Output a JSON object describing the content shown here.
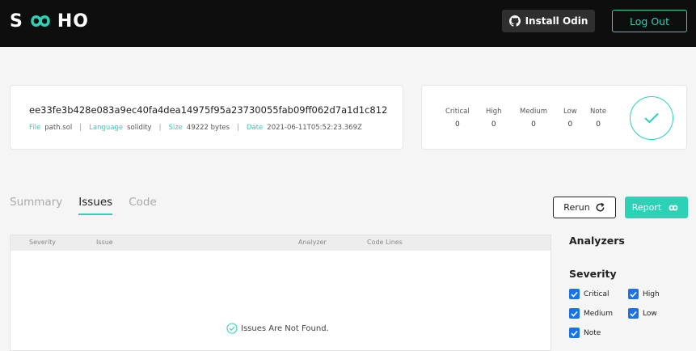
{
  "header": {
    "logo_left": "S",
    "logo_right": "HO",
    "install_label": "Install Odin",
    "logout_label": "Log Out"
  },
  "file": {
    "hash": "ee33fe3b428e083a9ec40fa4dea14975f95a23730055fab09ff062d7a1d1c812",
    "file_key": "File",
    "file_name": "path.sol",
    "language_key": "Language",
    "language": "solidity",
    "size_key": "Size",
    "size": "49222 bytes",
    "date_key": "Date",
    "date": "2021-06-11T05:52:23.369Z"
  },
  "severity_counts": [
    {
      "label": "Critical",
      "value": "0"
    },
    {
      "label": "High",
      "value": "0"
    },
    {
      "label": "Medium",
      "value": "0"
    },
    {
      "label": "Low",
      "value": "0"
    },
    {
      "label": "Note",
      "value": "0"
    }
  ],
  "tabs": [
    {
      "label": "Summary",
      "active": false
    },
    {
      "label": "Issues",
      "active": true
    },
    {
      "label": "Code",
      "active": false
    }
  ],
  "actions": {
    "rerun_label": "Rerun",
    "report_label": "Report"
  },
  "table": {
    "columns": [
      "Severity",
      "Issue",
      "Analyzer",
      "Code Lines"
    ],
    "empty_message": "Issues Are Not Found."
  },
  "sidebar": {
    "analyzers_title": "Analyzers",
    "severity_title": "Severity",
    "filters": [
      {
        "label": "Critical",
        "checked": true
      },
      {
        "label": "High",
        "checked": true
      },
      {
        "label": "Medium",
        "checked": true
      },
      {
        "label": "Low",
        "checked": true
      },
      {
        "label": "Note",
        "checked": true
      }
    ]
  },
  "colors": {
    "accent": "#2cd1b6",
    "topbar": "#0e0e0e",
    "checkbox": "#1a73e8"
  }
}
